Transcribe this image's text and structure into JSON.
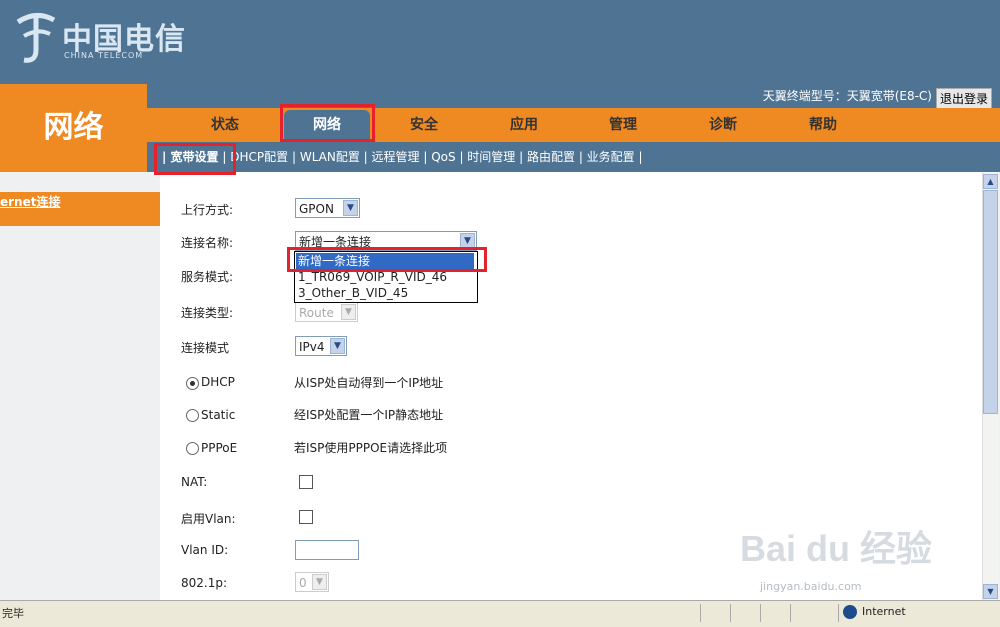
{
  "header": {
    "logo_cn": "中国电信",
    "logo_en": "CHINA TELECOM",
    "model_text": "天翼终端型号：天翼宽带(E8-C)",
    "logout_label": "退出登录"
  },
  "left_title": "网络",
  "main_nav": [
    "状态",
    "网络",
    "安全",
    "应用",
    "管理",
    "诊断",
    "帮助"
  ],
  "sub_nav": [
    "| 宽带设置",
    "| DHCP配置",
    "| WLAN配置",
    "| 远程管理",
    "| QoS",
    "| 时间管理",
    "| 路由配置",
    "| 业务配置",
    "|"
  ],
  "sidebar": {
    "item_label": "ernet连接"
  },
  "form": {
    "uplink_label": "上行方式:",
    "uplink_value": "GPON",
    "conn_name_label": "连接名称:",
    "conn_name_value": "新增一条连接",
    "service_mode_label": "服务模式:",
    "conn_type_label": "连接类型:",
    "conn_type_value": "Route",
    "conn_mode_label": "连接模式",
    "conn_mode_value": "IPv4",
    "dhcp_label": "DHCP",
    "dhcp_desc": "从ISP处自动得到一个IP地址",
    "static_label": "Static",
    "static_desc": "经ISP处配置一个IP静态地址",
    "pppoe_label": "PPPoE",
    "pppoe_desc": "若ISP使用PPPOE请选择此项",
    "nat_label": "NAT:",
    "vlan_enable_label": "启用Vlan:",
    "vlan_id_label": "Vlan ID:",
    "p8021_label": "802.1p:",
    "p8021_value": "0"
  },
  "dropdown_options": [
    "新增一条连接",
    "1_TR069_VOIP_R_VID_46",
    "3_Other_B_VID_45"
  ],
  "statusbar": {
    "status": "完毕",
    "zone": "Internet"
  },
  "watermark": {
    "main": "Bai du 经验",
    "sub": "jingyan.baidu.com"
  },
  "colors": {
    "orange": "#ef8a22",
    "blue": "#4f7493",
    "annotation": "#e5212b",
    "highlight": "#316ac5"
  }
}
